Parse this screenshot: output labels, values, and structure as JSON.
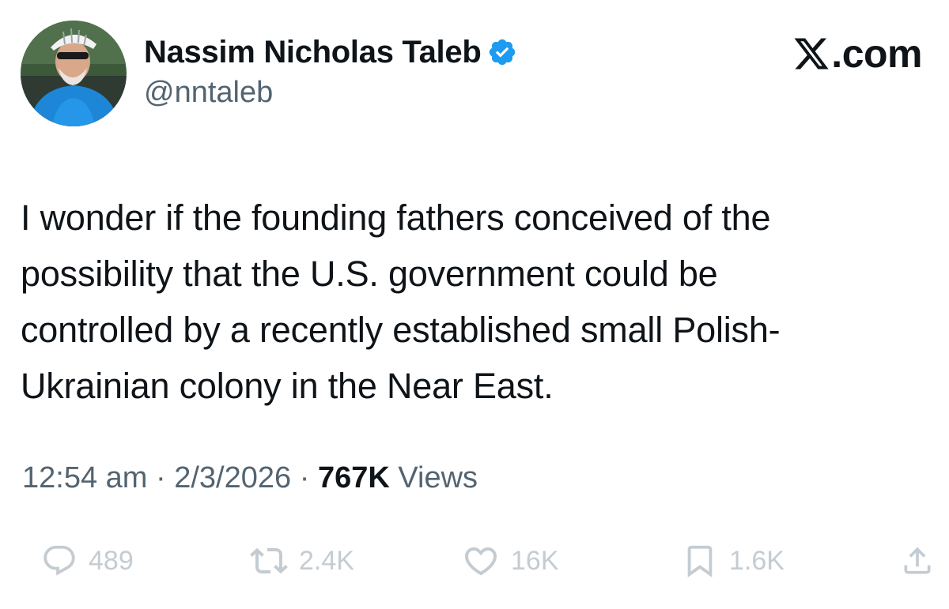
{
  "author": {
    "display_name": "Nassim Nicholas Taleb",
    "handle": "@nntaleb",
    "verified": true,
    "verified_color": "#1d9bf0"
  },
  "brand": {
    "suffix": ".com",
    "icon": "x-logo-icon"
  },
  "tweet": {
    "lines": [
      "I wonder if the founding fathers conceived of the",
      "possibility that the U.S. government could be",
      "controlled by a recently established small Polish-",
      "Ukrainian colony in the Near East."
    ]
  },
  "meta": {
    "time": "12:54 am",
    "separator": "·",
    "date": "2/3/2026",
    "views_count": "767K",
    "views_label": "Views"
  },
  "actions": {
    "replies": {
      "icon": "reply-icon",
      "count": "489"
    },
    "reposts": {
      "icon": "repost-icon",
      "count": "2.4K"
    },
    "likes": {
      "icon": "heart-icon",
      "count": "16K"
    },
    "bookmarks": {
      "icon": "bookmark-icon",
      "count": "1.6K"
    },
    "share": {
      "icon": "share-icon"
    }
  },
  "colors": {
    "text_primary": "#0f1419",
    "text_secondary": "#536471",
    "action_muted": "#c4ccd2",
    "accent": "#1d9bf0"
  }
}
